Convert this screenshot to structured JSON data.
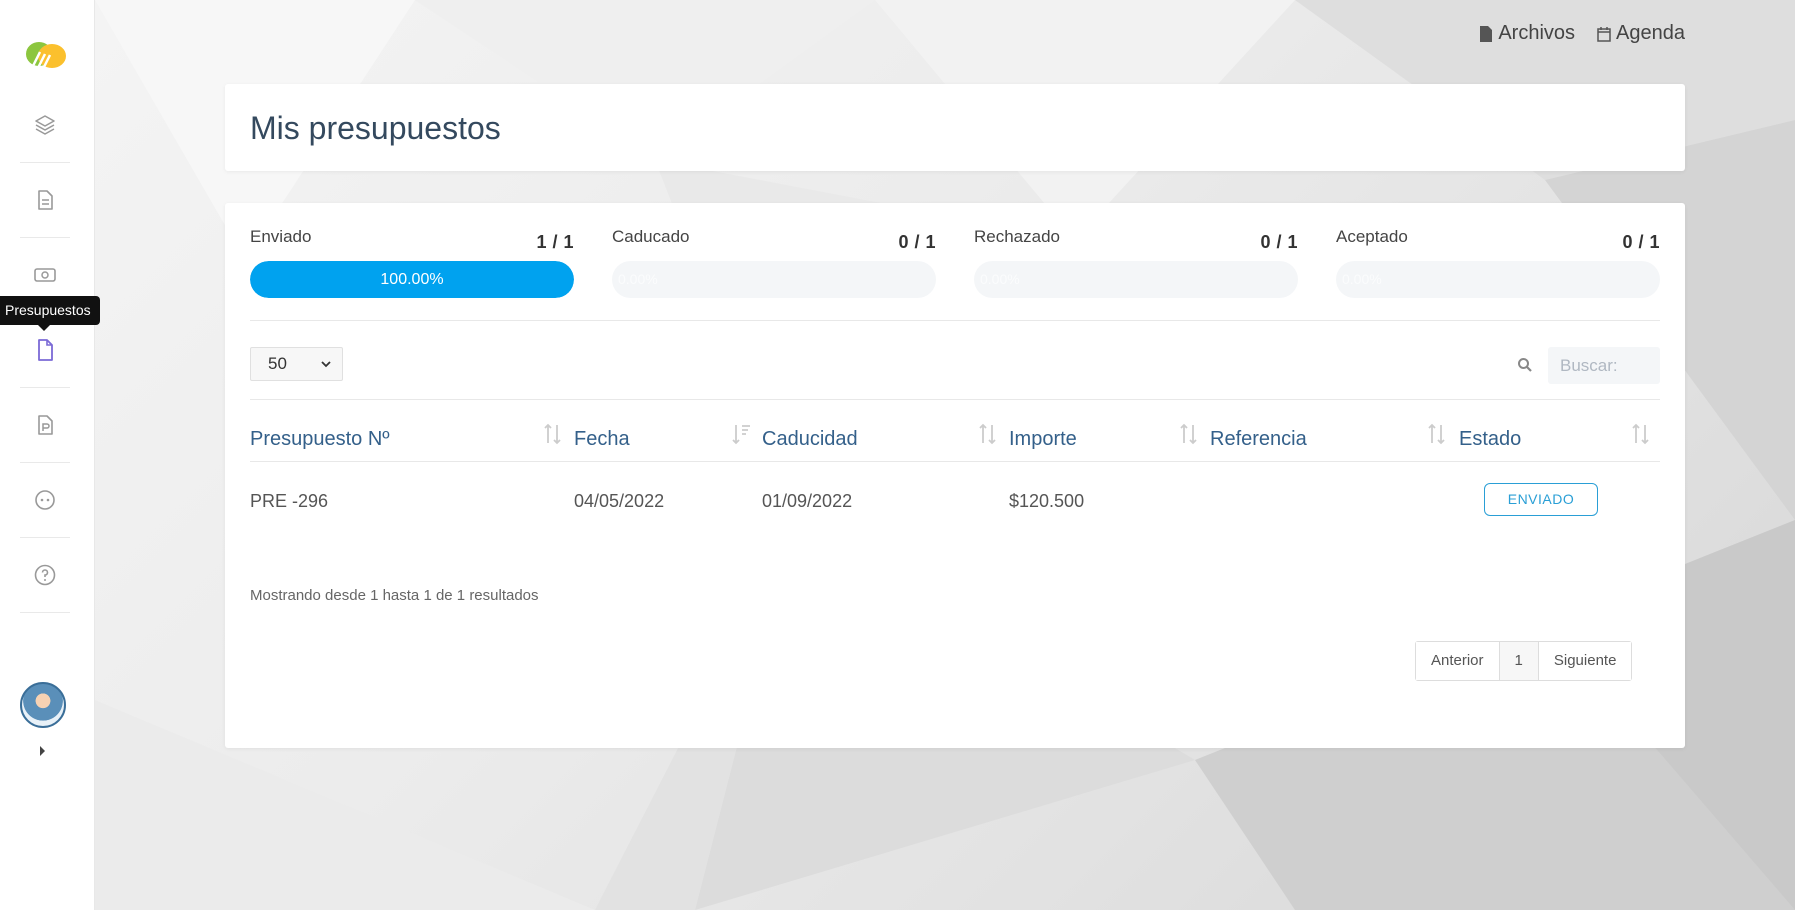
{
  "sidebar": {
    "tooltip": "Presupuestos",
    "items": [
      {
        "icon": "layers-icon"
      },
      {
        "icon": "document-icon"
      },
      {
        "icon": "money-icon"
      },
      {
        "icon": "file-icon",
        "active": true
      },
      {
        "icon": "invoice-icon"
      },
      {
        "icon": "chat-icon"
      },
      {
        "icon": "help-icon"
      }
    ]
  },
  "header": {
    "archivos": "Archivos",
    "agenda": "Agenda"
  },
  "page": {
    "title": "Mis presupuestos"
  },
  "stats": [
    {
      "label": "Enviado",
      "count": "1 / 1",
      "progress": 100,
      "progress_text": "100.00%"
    },
    {
      "label": "Caducado",
      "count": "0 / 1",
      "progress": 0,
      "progress_text": "0.00%"
    },
    {
      "label": "Rechazado",
      "count": "0 / 1",
      "progress": 0,
      "progress_text": "0.00%"
    },
    {
      "label": "Aceptado",
      "count": "0 / 1",
      "progress": 0,
      "progress_text": "0.00%"
    }
  ],
  "table": {
    "length": "50",
    "search_placeholder": "Buscar:",
    "columns": [
      "Presupuesto Nº",
      "Fecha",
      "Caducidad",
      "Importe",
      "Referencia",
      "Estado"
    ],
    "rows": [
      {
        "numero": "PRE -296",
        "fecha": "04/05/2022",
        "caducidad": "01/09/2022",
        "importe": "$120.500",
        "referencia": "",
        "estado": "ENVIADO"
      }
    ],
    "info": "Mostrando desde 1 hasta 1 de 1 resultados",
    "pagination": {
      "prev": "Anterior",
      "current": "1",
      "next": "Siguiente"
    }
  },
  "colors": {
    "accent": "#00a2ef",
    "title": "#34495e",
    "header_text": "#34608a",
    "status_border": "#2a9fd6"
  }
}
